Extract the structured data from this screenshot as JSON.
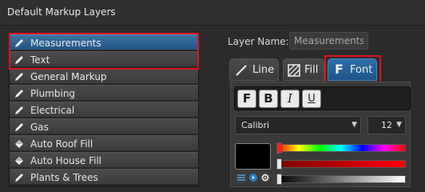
{
  "window": {
    "title": "Default Markup Layers"
  },
  "layers": [
    {
      "label": "Measurements",
      "icon": "pencil-icon",
      "selected": true
    },
    {
      "label": "Text",
      "icon": "pencil-icon",
      "selected": false
    },
    {
      "label": "General Markup",
      "icon": "pencil-icon",
      "selected": false
    },
    {
      "label": "Plumbing",
      "icon": "pencil-icon",
      "selected": false
    },
    {
      "label": "Electrical",
      "icon": "pencil-icon",
      "selected": false
    },
    {
      "label": "Gas",
      "icon": "pencil-icon",
      "selected": false
    },
    {
      "label": "Auto Roof Fill",
      "icon": "fill-bucket-icon",
      "selected": false
    },
    {
      "label": "Auto House Fill",
      "icon": "fill-bucket-icon",
      "selected": false
    },
    {
      "label": "Plants & Trees",
      "icon": "pencil-icon",
      "selected": false
    }
  ],
  "layer_name": {
    "label": "Layer Name:",
    "value": "Measurements"
  },
  "tabs": [
    {
      "label": "Line",
      "icon": "line-icon",
      "active": false
    },
    {
      "label": "Fill",
      "icon": "hatch-fill-icon",
      "active": false
    },
    {
      "label": "Font",
      "icon": "font-f-icon",
      "active": true
    }
  ],
  "font": {
    "style_buttons": [
      {
        "glyph": "F",
        "icon": "font-f-icon"
      },
      {
        "glyph": "B",
        "icon": "bold-icon"
      },
      {
        "glyph": "I",
        "icon": "italic-icon"
      },
      {
        "glyph": "U",
        "icon": "underline-icon"
      }
    ],
    "family": "Calibri",
    "size": "12"
  },
  "color": {
    "swatch": "#000000",
    "hue_level": 0.0,
    "alpha_level": 0.0,
    "brightness_level": 0.0
  },
  "accent": {
    "selection": "#2a6498",
    "highlight": "#e0141e"
  }
}
